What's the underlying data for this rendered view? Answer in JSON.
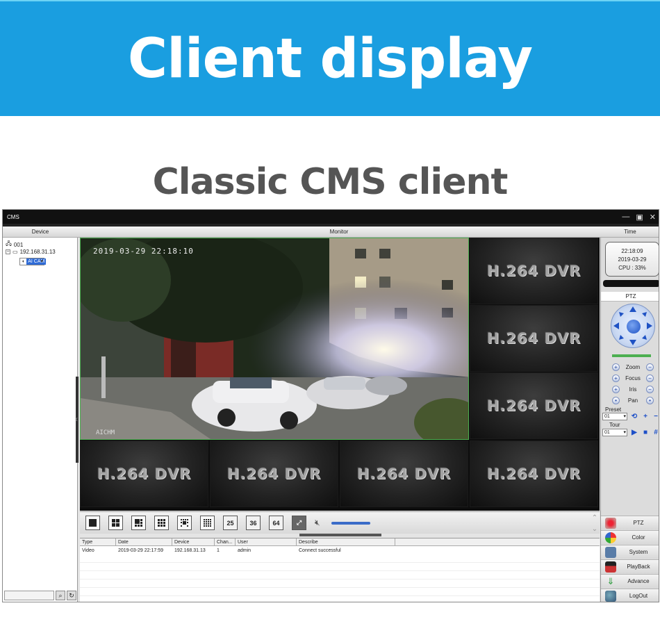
{
  "banner": {
    "title": "Client display"
  },
  "subtitle": "Classic CMS client",
  "window": {
    "title": "CMS",
    "minimize": "—",
    "restore": "▣",
    "close": "✕"
  },
  "headers": {
    "device": "Device",
    "monitor": "Monitor",
    "time": "Time"
  },
  "tree": {
    "root": "001",
    "ip": "192.168.31.13",
    "camera": "AI CAM"
  },
  "video": {
    "osd_time": "2019-03-29 22:18:10",
    "osd_name": "AICHM"
  },
  "tiles_text": "H.264 DVR",
  "toolbar": {
    "layouts": [
      "25",
      "36",
      "64"
    ]
  },
  "log": {
    "columns": [
      "Type",
      "Date",
      "Device",
      "Chan...",
      "User",
      "Describe"
    ],
    "rows": [
      [
        "Video",
        "2019-03-29 22:17:59",
        "192.168.31.13",
        "1",
        "admin",
        "Connect successful"
      ]
    ]
  },
  "clock": {
    "time": "22:18:09",
    "date": "2019-03-29",
    "cpu": "CPU : 33%"
  },
  "ptz": {
    "title": "PTZ",
    "controls": [
      "Zoom",
      "Focus",
      "Iris",
      "Pan"
    ],
    "preset_label": "Preset",
    "preset_value": "01",
    "tour_label": "Tour",
    "tour_value": "01"
  },
  "menu": [
    "PTZ",
    "Color",
    "System",
    "PlayBack",
    "Advance",
    "LogOut"
  ],
  "colors": {
    "banner": "#1a9ee0",
    "accent": "#2f6bd6",
    "live_border": "#4caf50"
  }
}
